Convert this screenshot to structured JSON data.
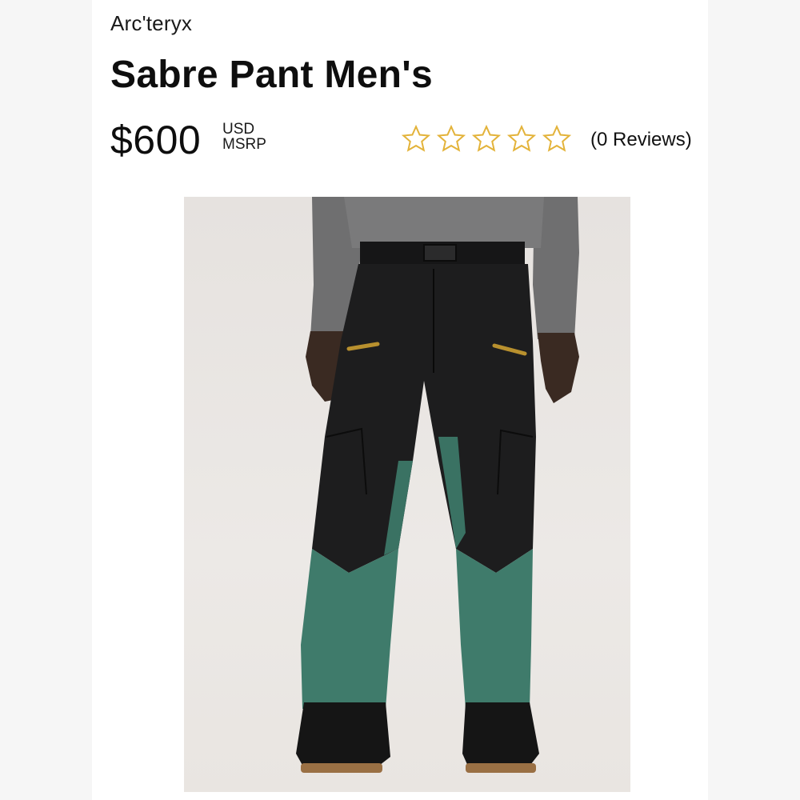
{
  "product": {
    "brand": "Arc'teryx",
    "title": "Sabre Pant Men's",
    "price": "$600",
    "currency": "USD",
    "price_type": "MSRP",
    "rating": 0,
    "rating_max": 5,
    "reviews_label": "(0 Reviews)"
  },
  "image": {
    "subject": "model wearing black and teal ski pants with gray long-sleeve top and black snowboard boots"
  },
  "colors": {
    "star_outline": "#e3b33a",
    "pant_black": "#1d1d1e",
    "pant_teal": "#3f7b6b",
    "zip_gold": "#b8902e",
    "shirt_gray": "#6f6f70"
  }
}
